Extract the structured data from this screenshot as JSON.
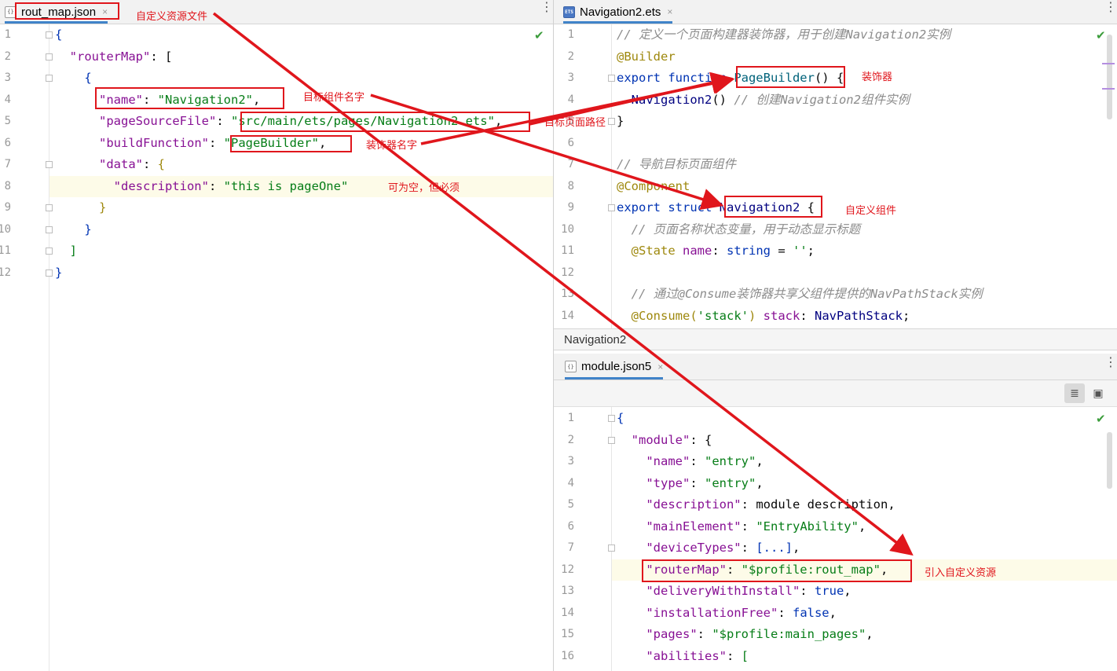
{
  "left_pane": {
    "tab_label": "rout_map.json",
    "tab_icon": "json-file-icon",
    "line_numbers": [
      "1",
      "2",
      "3",
      "4",
      "5",
      "6",
      "7",
      "8",
      "9",
      "10",
      "11",
      "12"
    ],
    "lines": [
      [
        {
          "t": "{",
          "c": "k"
        }
      ],
      [
        {
          "t": "  ",
          "c": ""
        },
        {
          "t": "\"routerMap\"",
          "c": "p"
        },
        {
          "t": ": [",
          "c": ""
        }
      ],
      [
        {
          "t": "    {",
          "c": "k"
        }
      ],
      [
        {
          "t": "      ",
          "c": ""
        },
        {
          "t": "\"name\"",
          "c": "p"
        },
        {
          "t": ": ",
          "c": ""
        },
        {
          "t": "\"Navigation2\"",
          "c": "s"
        },
        {
          "t": ",",
          "c": ""
        }
      ],
      [
        {
          "t": "      ",
          "c": ""
        },
        {
          "t": "\"pageSourceFile\"",
          "c": "p"
        },
        {
          "t": ": ",
          "c": ""
        },
        {
          "t": "\"src/main/ets/pages/Navigation2.ets\"",
          "c": "s"
        },
        {
          "t": ",",
          "c": ""
        }
      ],
      [
        {
          "t": "      ",
          "c": ""
        },
        {
          "t": "\"buildFunction\"",
          "c": "p"
        },
        {
          "t": ": ",
          "c": ""
        },
        {
          "t": "\"PageBuilder\"",
          "c": "s"
        },
        {
          "t": ",",
          "c": ""
        }
      ],
      [
        {
          "t": "      ",
          "c": ""
        },
        {
          "t": "\"data\"",
          "c": "p"
        },
        {
          "t": ": ",
          "c": ""
        },
        {
          "t": "{",
          "c": "a"
        }
      ],
      [
        {
          "t": "        ",
          "c": ""
        },
        {
          "t": "\"description\"",
          "c": "p"
        },
        {
          "t": ": ",
          "c": ""
        },
        {
          "t": "\"this is pageOne\"",
          "c": "s"
        }
      ],
      [
        {
          "t": "      }",
          "c": "a"
        }
      ],
      [
        {
          "t": "    }",
          "c": "k"
        }
      ],
      [
        {
          "t": "  ]",
          "c": "s"
        }
      ],
      [
        {
          "t": "}",
          "c": "k"
        }
      ]
    ]
  },
  "nav_pane": {
    "tab_label": "Navigation2.ets",
    "tab_icon_text": "ETS",
    "line_numbers": [
      "1",
      "2",
      "3",
      "4",
      "5",
      "6",
      "7",
      "8",
      "9",
      "10",
      "11",
      "12",
      "13",
      "14"
    ],
    "lines": [
      [
        {
          "t": "// 定义一个页面构建器装饰器，用于创建Navigation2实例",
          "c": "c"
        }
      ],
      [
        {
          "t": "@Builder",
          "c": "a"
        }
      ],
      [
        {
          "t": "export function ",
          "c": "k"
        },
        {
          "t": "PageBuilder",
          "c": "f"
        },
        {
          "t": "() {",
          "c": ""
        }
      ],
      [
        {
          "t": "  ",
          "c": ""
        },
        {
          "t": "Navigation2",
          "c": "t"
        },
        {
          "t": "() ",
          "c": ""
        },
        {
          "t": "// 创建Navigation2组件实例",
          "c": "c"
        }
      ],
      [
        {
          "t": "}",
          "c": ""
        }
      ],
      [
        {
          "t": "",
          "c": ""
        }
      ],
      [
        {
          "t": "// 导航目标页面组件",
          "c": "c"
        }
      ],
      [
        {
          "t": "@Component",
          "c": "a"
        }
      ],
      [
        {
          "t": "export struct ",
          "c": "k"
        },
        {
          "t": "Navigation2",
          "c": "t"
        },
        {
          "t": " {",
          "c": ""
        }
      ],
      [
        {
          "t": "  ",
          "c": ""
        },
        {
          "t": "// 页面名称状态变量，用于动态显示标题",
          "c": "c"
        }
      ],
      [
        {
          "t": "  ",
          "c": ""
        },
        {
          "t": "@State ",
          "c": "a"
        },
        {
          "t": "name",
          "c": "p"
        },
        {
          "t": ": ",
          "c": ""
        },
        {
          "t": "string",
          "c": "k"
        },
        {
          "t": " = ",
          "c": ""
        },
        {
          "t": "''",
          "c": "s"
        },
        {
          "t": ";",
          "c": ""
        }
      ],
      [
        {
          "t": "",
          "c": ""
        }
      ],
      [
        {
          "t": "  ",
          "c": ""
        },
        {
          "t": "// 通过@Consume装饰器共享父组件提供的NavPathStack实例",
          "c": "c"
        }
      ],
      [
        {
          "t": "  ",
          "c": ""
        },
        {
          "t": "@Consume(",
          "c": "a"
        },
        {
          "t": "'stack'",
          "c": "s"
        },
        {
          "t": ") ",
          "c": "a"
        },
        {
          "t": "stack",
          "c": "p"
        },
        {
          "t": ": ",
          "c": ""
        },
        {
          "t": "NavPathStack",
          "c": "t"
        },
        {
          "t": ";",
          "c": ""
        }
      ]
    ]
  },
  "breadcrumb": "Navigation2",
  "module_pane": {
    "tab_label": "module.json5",
    "line_numbers": [
      "1",
      "2",
      "3",
      "4",
      "5",
      "6",
      "7",
      "12",
      "13",
      "14",
      "15",
      "16"
    ],
    "lines": [
      [
        {
          "t": "{",
          "c": "k"
        }
      ],
      [
        {
          "t": "  ",
          "c": ""
        },
        {
          "t": "\"module\"",
          "c": "p"
        },
        {
          "t": ": {",
          "c": ""
        }
      ],
      [
        {
          "t": "    ",
          "c": ""
        },
        {
          "t": "\"name\"",
          "c": "p"
        },
        {
          "t": ": ",
          "c": ""
        },
        {
          "t": "\"entry\"",
          "c": "s"
        },
        {
          "t": ",",
          "c": ""
        }
      ],
      [
        {
          "t": "    ",
          "c": ""
        },
        {
          "t": "\"type\"",
          "c": "p"
        },
        {
          "t": ": ",
          "c": ""
        },
        {
          "t": "\"entry\"",
          "c": "s"
        },
        {
          "t": ",",
          "c": ""
        }
      ],
      [
        {
          "t": "    ",
          "c": ""
        },
        {
          "t": "\"description\"",
          "c": "p"
        },
        {
          "t": ": ",
          "c": ""
        },
        {
          "t": "module description",
          "c": ""
        },
        {
          "t": ",",
          "c": ""
        }
      ],
      [
        {
          "t": "    ",
          "c": ""
        },
        {
          "t": "\"mainElement\"",
          "c": "p"
        },
        {
          "t": ": ",
          "c": ""
        },
        {
          "t": "\"EntryAbility\"",
          "c": "s"
        },
        {
          "t": ",",
          "c": ""
        }
      ],
      [
        {
          "t": "    ",
          "c": ""
        },
        {
          "t": "\"deviceTypes\"",
          "c": "p"
        },
        {
          "t": ": ",
          "c": ""
        },
        {
          "t": "[...]",
          "c": "k"
        },
        {
          "t": ",",
          "c": ""
        }
      ],
      [
        {
          "t": "    ",
          "c": ""
        },
        {
          "t": "\"routerMap\"",
          "c": "p"
        },
        {
          "t": ": ",
          "c": ""
        },
        {
          "t": "\"$profile:rout_map\"",
          "c": "s"
        },
        {
          "t": ",",
          "c": ""
        }
      ],
      [
        {
          "t": "    ",
          "c": ""
        },
        {
          "t": "\"deliveryWithInstall\"",
          "c": "p"
        },
        {
          "t": ": ",
          "c": ""
        },
        {
          "t": "true",
          "c": "k"
        },
        {
          "t": ",",
          "c": ""
        }
      ],
      [
        {
          "t": "    ",
          "c": ""
        },
        {
          "t": "\"installationFree\"",
          "c": "p"
        },
        {
          "t": ": ",
          "c": ""
        },
        {
          "t": "false",
          "c": "k"
        },
        {
          "t": ",",
          "c": ""
        }
      ],
      [
        {
          "t": "    ",
          "c": ""
        },
        {
          "t": "\"pages\"",
          "c": "p"
        },
        {
          "t": ": ",
          "c": ""
        },
        {
          "t": "\"$profile:main_pages\"",
          "c": "s"
        },
        {
          "t": ",",
          "c": ""
        }
      ],
      [
        {
          "t": "    ",
          "c": ""
        },
        {
          "t": "\"abilities\"",
          "c": "p"
        },
        {
          "t": ": ",
          "c": ""
        },
        {
          "t": "[",
          "c": "s"
        }
      ]
    ]
  },
  "annotations": {
    "custom_resource_file": "自定义资源文件",
    "target_component_name": "目标组件名字",
    "target_page_path": "目标页面路径",
    "decorator_name": "装饰器名字",
    "may_be_empty": "可为空，但必须",
    "decorator": "装饰器",
    "custom_component": "自定义组件",
    "import_custom_resource": "引入自定义资源"
  },
  "colors": {
    "annotation_red": "#e0161c",
    "keyword_blue": "#0033b3",
    "string_green": "#067d17",
    "property_purple": "#871094",
    "comment_gray": "#8c8c8c",
    "check_green": "#3c9d3c"
  },
  "icons": [
    "json-file-icon",
    "ets-file-icon",
    "close-icon",
    "more-options-icon",
    "check-icon",
    "fold-icon",
    "reader-mode-icon",
    "image-icon"
  ]
}
